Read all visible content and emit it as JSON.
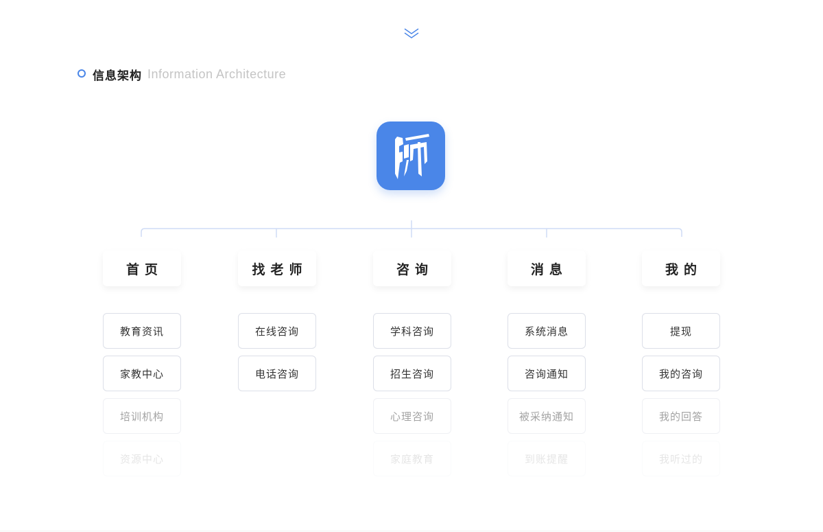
{
  "header": {
    "title_cn": "信息架构",
    "title_en": "Information Architecture"
  },
  "app": {
    "logo_text": "師",
    "accent_color": "#4a86e8"
  },
  "columns": [
    {
      "label": "首页",
      "items": [
        "教育资讯",
        "家教中心",
        "培训机构",
        "资源中心"
      ]
    },
    {
      "label": "找老师",
      "items": [
        "在线咨询",
        "电话咨询"
      ]
    },
    {
      "label": "咨询",
      "items": [
        "学科咨询",
        "招生咨询",
        "心理咨询",
        "家庭教育"
      ]
    },
    {
      "label": "消息",
      "items": [
        "系统消息",
        "咨询通知",
        "被采纳通知",
        "到账提醒"
      ]
    },
    {
      "label": "我的",
      "items": [
        "提现",
        "我的咨询",
        "我的回答",
        "我听过的"
      ]
    }
  ]
}
